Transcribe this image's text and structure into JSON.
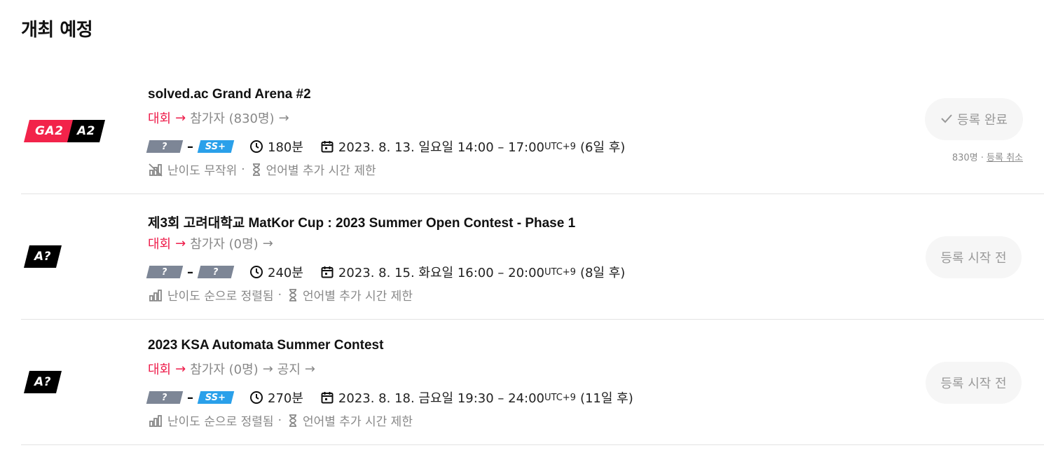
{
  "section_title": "개최 예정",
  "contests": [
    {
      "badges": [
        "GA2",
        "A2"
      ],
      "title": "solved.ac Grand Arena #2",
      "crumb_contest": "대회",
      "crumb_participants": "참가자 (830명)",
      "crumb_notice": "",
      "tier_from": "?",
      "tier_to": "SS+",
      "duration": "180분",
      "datetime": "2023. 8. 13. 일요일 14:00 – 17:00",
      "tz": "UTC+9",
      "relative": "(6일 후)",
      "extra_1": "난이도 무작위",
      "extra_2": "언어별 추가 시간 제한",
      "button_label": "등록 완료",
      "sub_count": "830명 · ",
      "sub_link": "등록 취소"
    },
    {
      "badges": [
        "A?"
      ],
      "title": "제3회 고려대학교 MatKor Cup : 2023 Summer Open Contest - Phase 1",
      "crumb_contest": "대회",
      "crumb_participants": "참가자 (0명)",
      "crumb_notice": "",
      "tier_from": "?",
      "tier_to": "?",
      "duration": "240분",
      "datetime": "2023. 8. 15. 화요일 16:00 – 20:00",
      "tz": "UTC+9",
      "relative": "(8일 후)",
      "extra_1": "난이도 순으로 정렬됨",
      "extra_2": "언어별 추가 시간 제한",
      "button_label": "등록 시작 전"
    },
    {
      "badges": [
        "A?"
      ],
      "title": "2023 KSA Automata Summer Contest",
      "crumb_contest": "대회",
      "crumb_participants": "참가자 (0명)",
      "crumb_notice": "공지",
      "tier_from": "?",
      "tier_to": "SS+",
      "duration": "270분",
      "datetime": "2023. 8. 18. 금요일 19:30 – 24:00",
      "tz": "UTC+9",
      "relative": "(11일 후)",
      "extra_1": "난이도 순으로 정렬됨",
      "extra_2": "언어별 추가 시간 제한",
      "button_label": "등록 시작 전"
    }
  ],
  "colors": {
    "accent_red": "#ee1c4a",
    "tier_gray": "#7d8696",
    "tier_blue": "#2aa0ea"
  }
}
